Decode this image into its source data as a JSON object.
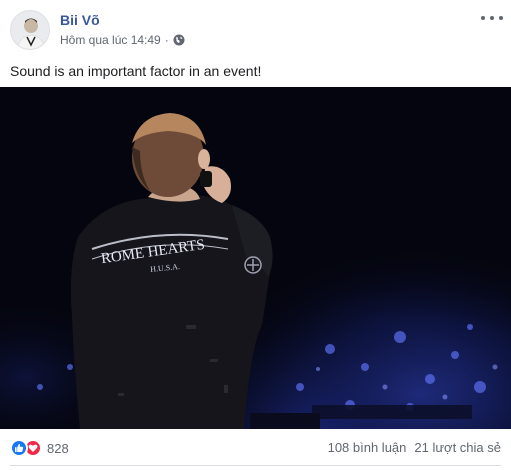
{
  "post": {
    "author": "Bii Võ",
    "time": "Hôm qua lúc 14:49",
    "separator": "·",
    "privacy_icon": "globe-icon",
    "text": "Sound is an important factor in an event!"
  },
  "footer": {
    "reaction_icons": [
      "like-icon",
      "love-icon"
    ],
    "reaction_count": "828",
    "comments": "108 bình luận",
    "shares": "21 lượt chia sẻ"
  },
  "colors": {
    "author_link": "#385898",
    "meta_text": "#606770",
    "like": "#1877f2",
    "love": "#f0284a",
    "photo_bg": "#04050e"
  }
}
